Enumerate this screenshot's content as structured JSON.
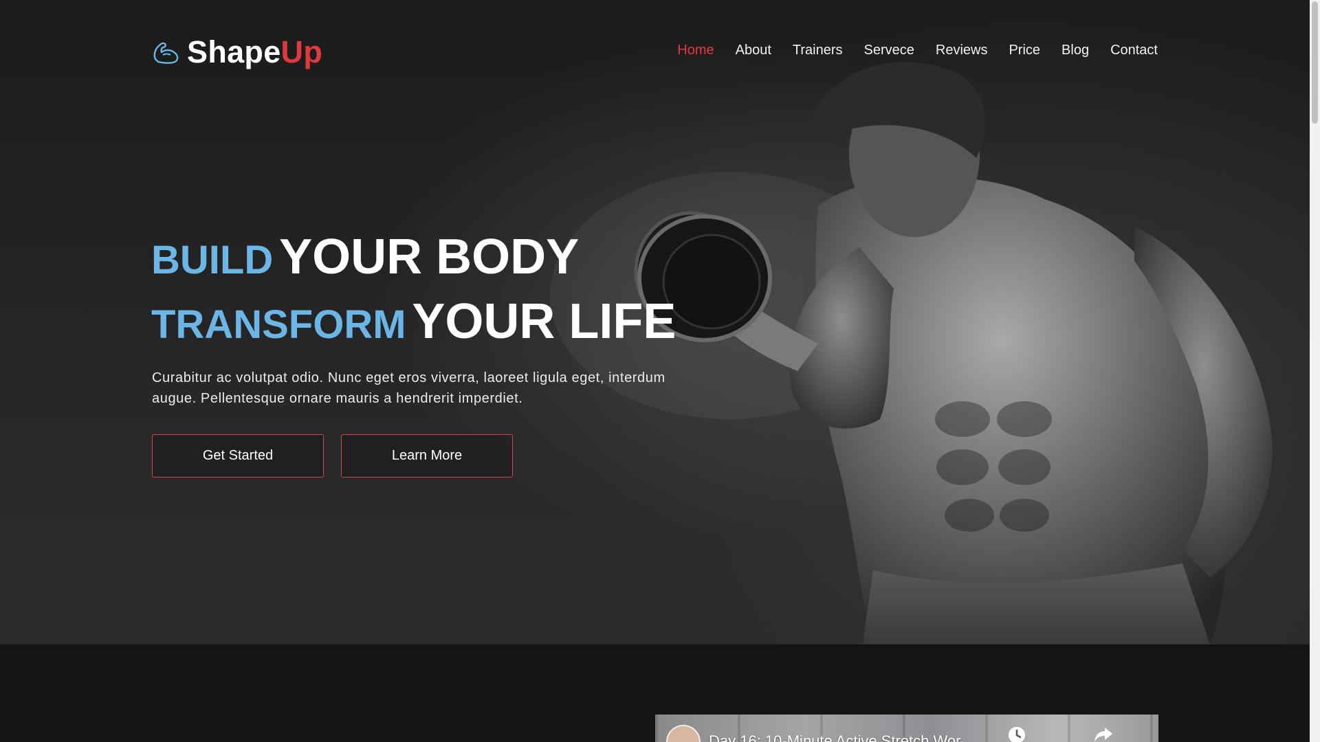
{
  "brand": {
    "name_part1": "Shape",
    "name_part2": "Up",
    "accent_color": "#e0393e"
  },
  "nav": {
    "items": [
      {
        "label": "Home",
        "active": true
      },
      {
        "label": "About",
        "active": false
      },
      {
        "label": "Trainers",
        "active": false
      },
      {
        "label": "Servece",
        "active": false
      },
      {
        "label": "Reviews",
        "active": false
      },
      {
        "label": "Price",
        "active": false
      },
      {
        "label": "Blog",
        "active": false
      },
      {
        "label": "Contact",
        "active": false
      }
    ]
  },
  "hero": {
    "line1_accent": "BUILD",
    "line1_rest": "YOUR BODY",
    "line2_accent": "TRANSFORM",
    "line2_rest": "YOUR LIFE",
    "accent_color": "#6bb6e6",
    "description": "Curabitur ac volutpat odio. Nunc eget eros viverra, laoreet ligula eget, interdum augue. Pellentesque ornare mauris a hendrerit imperdiet.",
    "primary_button": "Get Started",
    "secondary_button": "Learn More"
  },
  "video": {
    "title": "Day 16: 10-Minute Active Stretch Wor",
    "icons": [
      "clock-icon",
      "share-icon"
    ]
  }
}
